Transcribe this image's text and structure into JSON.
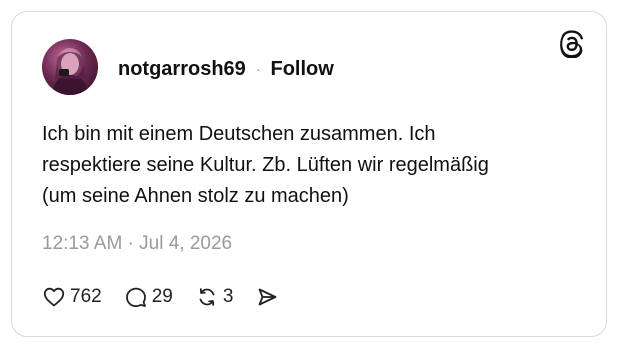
{
  "post": {
    "username": "notgarrosh69",
    "separator": "·",
    "follow_label": "Follow",
    "text_lines": [
      "Ich bin mit einem Deutschen zusammen. Ich",
      "respektiere seine Kultur. Zb. Lüften wir regelmäßig",
      "(um seine Ahnen stolz zu machen)"
    ],
    "timestamp": "12:13 AM · Jul 4, 2026",
    "likes": "762",
    "replies": "29",
    "reposts": "3"
  },
  "icons": {
    "brand": "threads-logo-icon",
    "like": "heart-icon",
    "reply": "comment-bubble-icon",
    "repost": "repost-icon",
    "share": "send-icon"
  },
  "colors": {
    "text": "#111111",
    "muted": "#9a9a9a",
    "border": "#d9d9d9"
  }
}
